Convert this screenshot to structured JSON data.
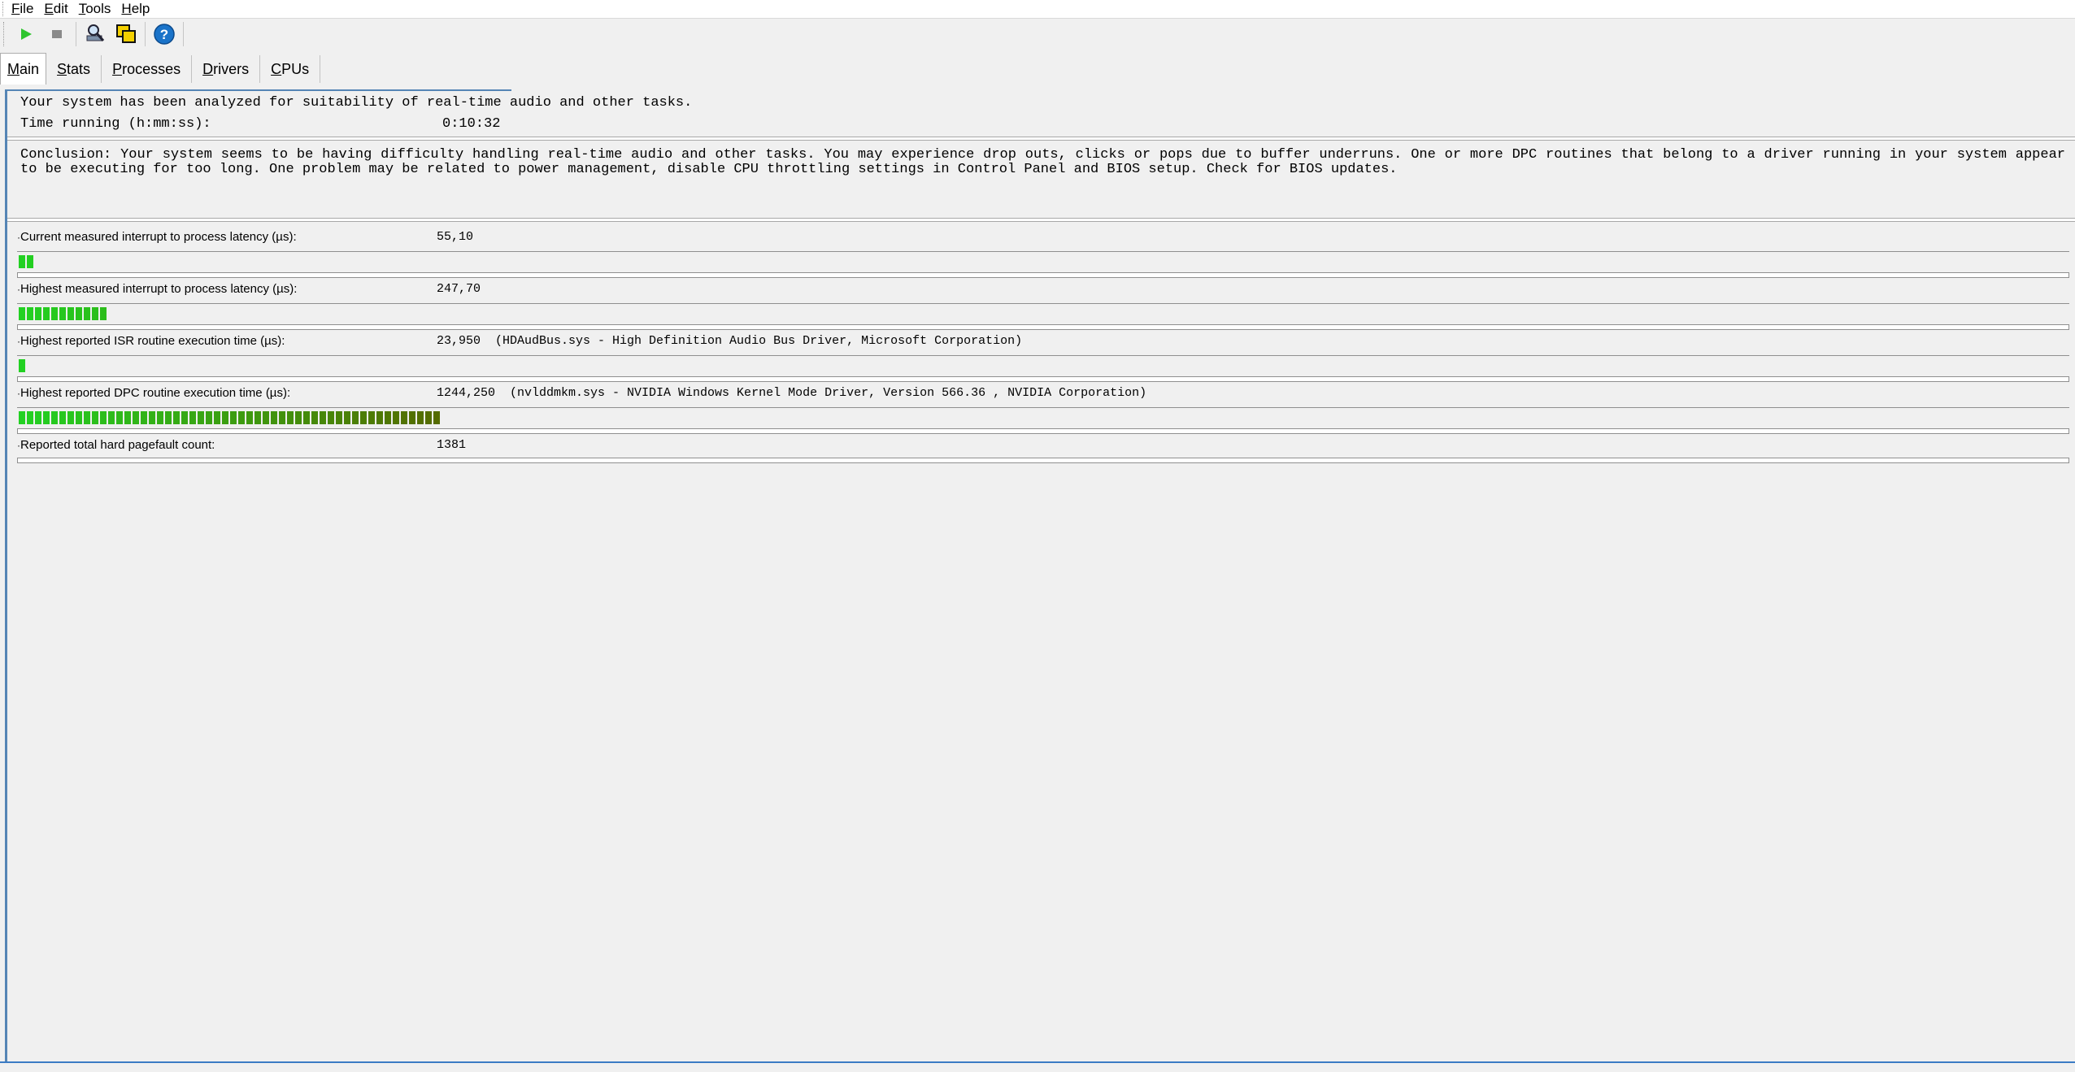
{
  "menu": [
    "File",
    "Edit",
    "Tools",
    "Help"
  ],
  "toolbar": {
    "buttons": [
      {
        "name": "start",
        "icon": "play-icon",
        "color": "#2ec52e"
      },
      {
        "name": "stop",
        "icon": "stop-icon",
        "color": "#8a8a8a"
      },
      {
        "name": "analyze",
        "icon": "search-tool-icon"
      },
      {
        "name": "copy",
        "icon": "copy-windows-icon"
      },
      {
        "name": "help",
        "icon": "help-icon",
        "color": "#1a73c9"
      }
    ]
  },
  "tabs": [
    "Main",
    "Stats",
    "Processes",
    "Drivers",
    "CPUs"
  ],
  "active_tab": "Main",
  "status": {
    "analyzed": "Your system has been analyzed for suitability of real-time audio and other tasks.",
    "time_label": "Time running (h:mm:ss):",
    "time_value": "0:10:32"
  },
  "conclusion": "Conclusion: Your system seems to be having difficulty handling real-time audio and other tasks. You may experience drop outs, clicks or pops due to buffer underruns. One or more DPC routines that belong to a driver running in your system appear to be executing for too long. One problem may be related to power management, disable CPU throttling settings in Control Panel and BIOS setup. Check for BIOS updates.",
  "metrics": [
    {
      "label": "Current measured interrupt to process latency (µs):",
      "value": "55,10",
      "segments": 2
    },
    {
      "label": "Highest measured interrupt to process latency (µs):",
      "value": "247,70",
      "segments": 11
    },
    {
      "label": "Highest reported ISR routine execution time (µs):",
      "value": "23,950  (HDAudBus.sys - High Definition Audio Bus Driver, Microsoft Corporation)",
      "segments": 1
    },
    {
      "label": "Highest reported DPC routine execution time (µs):",
      "value": "1244,250  (nvlddmkm.sys - NVIDIA Windows Kernel Mode Driver, Version 566.36 , NVIDIA Corporation)",
      "segments": 52
    },
    {
      "label": "Reported total hard pagefault count:",
      "value": "1381",
      "segments": 0
    }
  ],
  "colors": {
    "bar_green": "#22d122",
    "bar_dark": "#556b00",
    "accent": "#5585b5"
  }
}
